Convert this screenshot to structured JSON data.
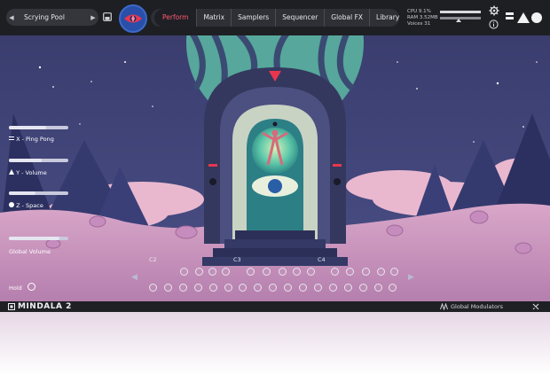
{
  "topbar": {
    "preset_name": "Scrying Pool",
    "prev_arrow": "◀",
    "next_arrow": "▶",
    "tabs": [
      {
        "label": "Perform",
        "active": true
      },
      {
        "label": "Matrix",
        "active": false
      },
      {
        "label": "Samplers",
        "active": false
      },
      {
        "label": "Sequencer",
        "active": false
      },
      {
        "label": "Global FX",
        "active": false
      },
      {
        "label": "Library",
        "active": false
      }
    ],
    "stats": {
      "cpu": "CPU  9.1%",
      "ram": "RAM  3.52MB",
      "voices": "Voices  31"
    }
  },
  "controls": {
    "x_label": "X - Ping Pong",
    "y_label": "Y - Volume",
    "z_label": "Z - Space",
    "volume_label": "Global Volume",
    "hold_label": "Hold"
  },
  "keyboard": {
    "octaves": [
      "C2",
      "C3",
      "C4"
    ]
  },
  "footer": {
    "product_name": "MINDALA 2",
    "modulators_label": "Global Modulators"
  },
  "colors": {
    "accent": "#ff5a70",
    "sky": "#3f4476",
    "topbar": "#1e1f23"
  }
}
